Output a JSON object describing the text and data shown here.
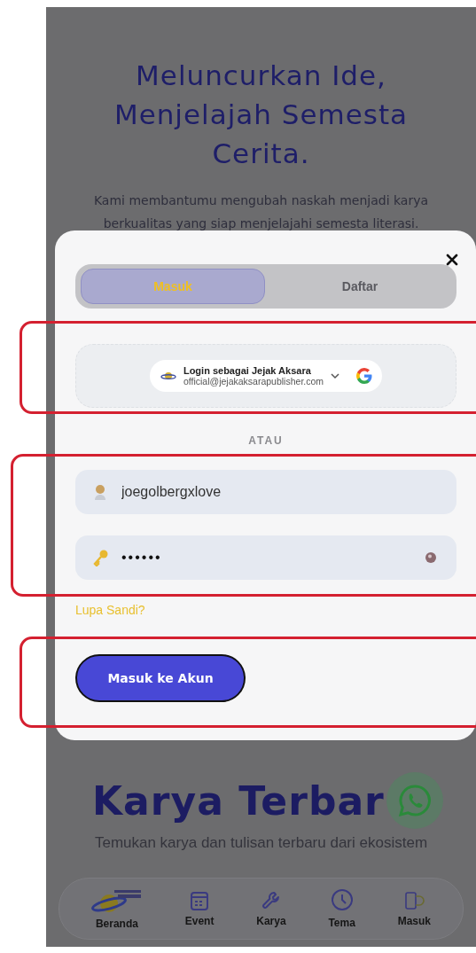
{
  "hero": {
    "title": "Meluncurkan Ide, Menjelajah Semesta Cerita.",
    "subtitle": "Kami membantumu mengubah naskah menjadi karya berkualitas yang siap menjelajahi semesta literasi."
  },
  "login_dialog": {
    "tabs": [
      {
        "label": "Masuk",
        "selected": true
      },
      {
        "label": "Daftar",
        "selected": false
      }
    ],
    "google_signin": {
      "title": "Login sebagai Jejak Aksara",
      "email": "official@jejakaksarapublisher.com"
    },
    "divider": "ATAU",
    "username": {
      "value": "joegolbergxlove"
    },
    "password": {
      "value": "••••••"
    },
    "forgot_link": "Lupa Sandi?",
    "submit": "Masuk ke Akun"
  },
  "section": {
    "title": "Karya Terbar",
    "subtitle": "Temukan karya dan tulisan terbaru dari ekosistem"
  },
  "bottom_nav": [
    {
      "kind": "logo",
      "label": "Beranda"
    },
    {
      "kind": "calendar",
      "label": "Event"
    },
    {
      "kind": "wrench",
      "label": "Karya"
    },
    {
      "kind": "clock",
      "label": "Tema"
    },
    {
      "kind": "door",
      "label": "Masuk"
    }
  ]
}
